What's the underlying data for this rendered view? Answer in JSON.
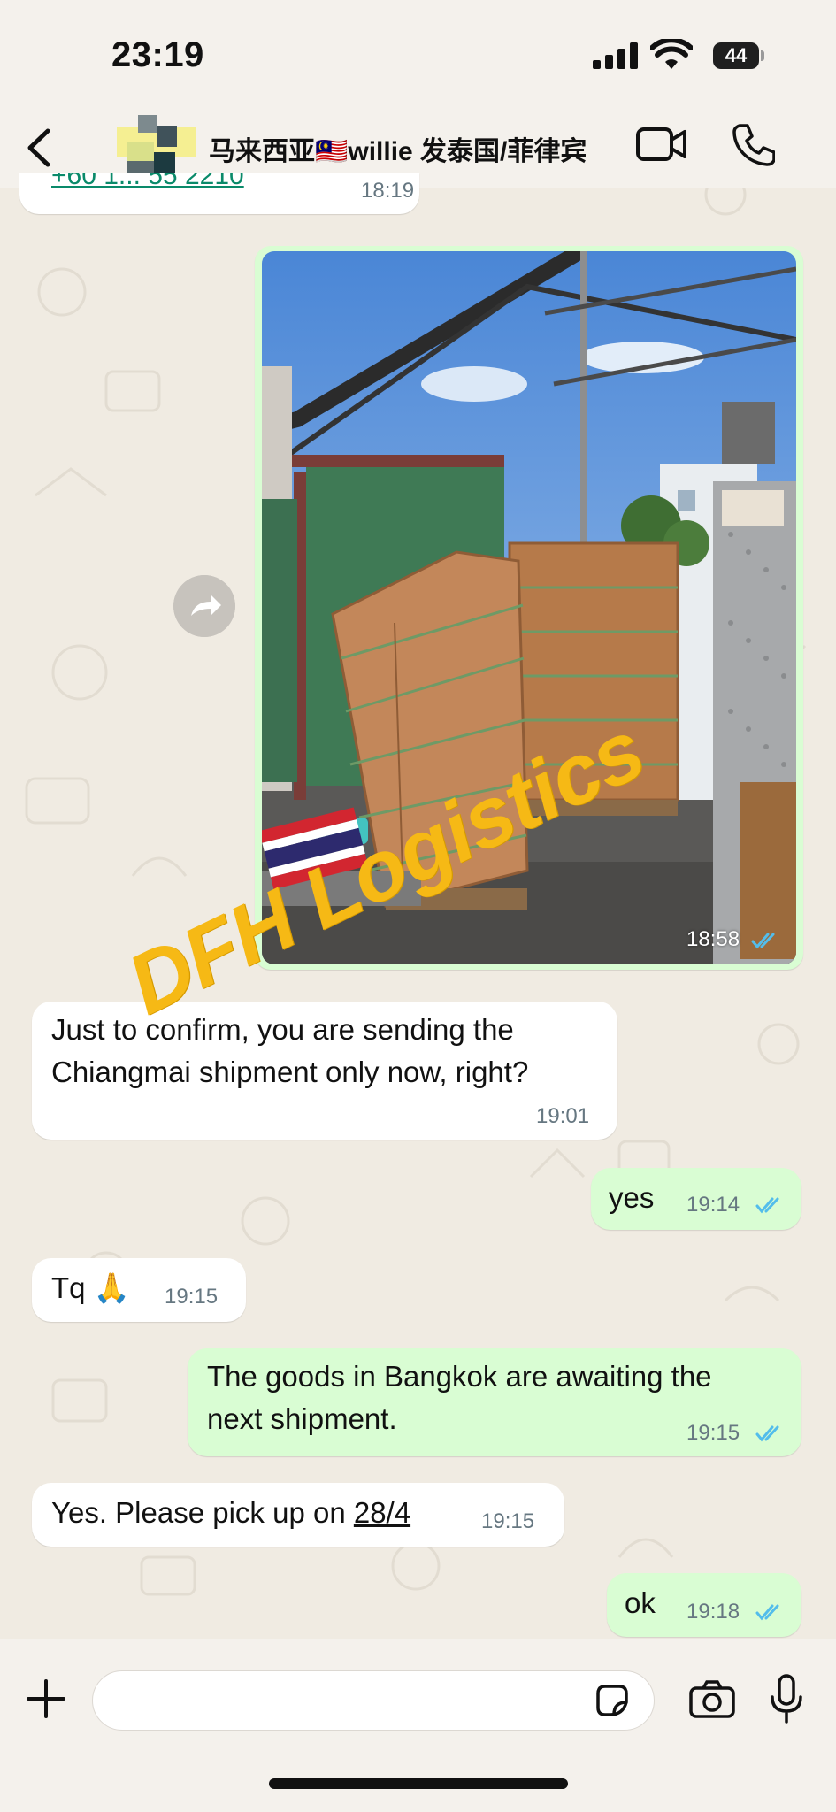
{
  "status_bar": {
    "time": "23:19",
    "battery": "44"
  },
  "header": {
    "title": "马来西亚🇲🇾willie 发泰国/菲律宾"
  },
  "colors": {
    "incoming": "#ffffff",
    "outgoing": "#d9fdd3",
    "tick": "#53bdeb",
    "watermark": "#f6b915"
  },
  "partial_message": {
    "text": "+60 1... 55 2210",
    "time": "18:19"
  },
  "photo_message": {
    "time": "18:58",
    "watermark": "DFH Logistics"
  },
  "messages": [
    {
      "line1": "Just to confirm, you are sending the",
      "line2": "Chiangmai  shipment only now, right?",
      "time": "19:01"
    },
    {
      "text": "yes",
      "time": "19:14"
    },
    {
      "text": "Tq 🙏",
      "time": "19:15"
    },
    {
      "line1": "The goods in Bangkok are awaiting the",
      "line2": "next shipment.",
      "time": "19:15"
    },
    {
      "text_pre": "Yes. Please pick up on ",
      "text_link": "28/4",
      "time": "19:15"
    },
    {
      "text": "ok",
      "time": "19:18"
    }
  ],
  "icons": [
    "back-chevron-icon",
    "video-call-icon",
    "phone-call-icon",
    "forward-icon",
    "plus-icon",
    "sticker-icon",
    "camera-icon",
    "mic-icon",
    "read-receipt-icon"
  ]
}
